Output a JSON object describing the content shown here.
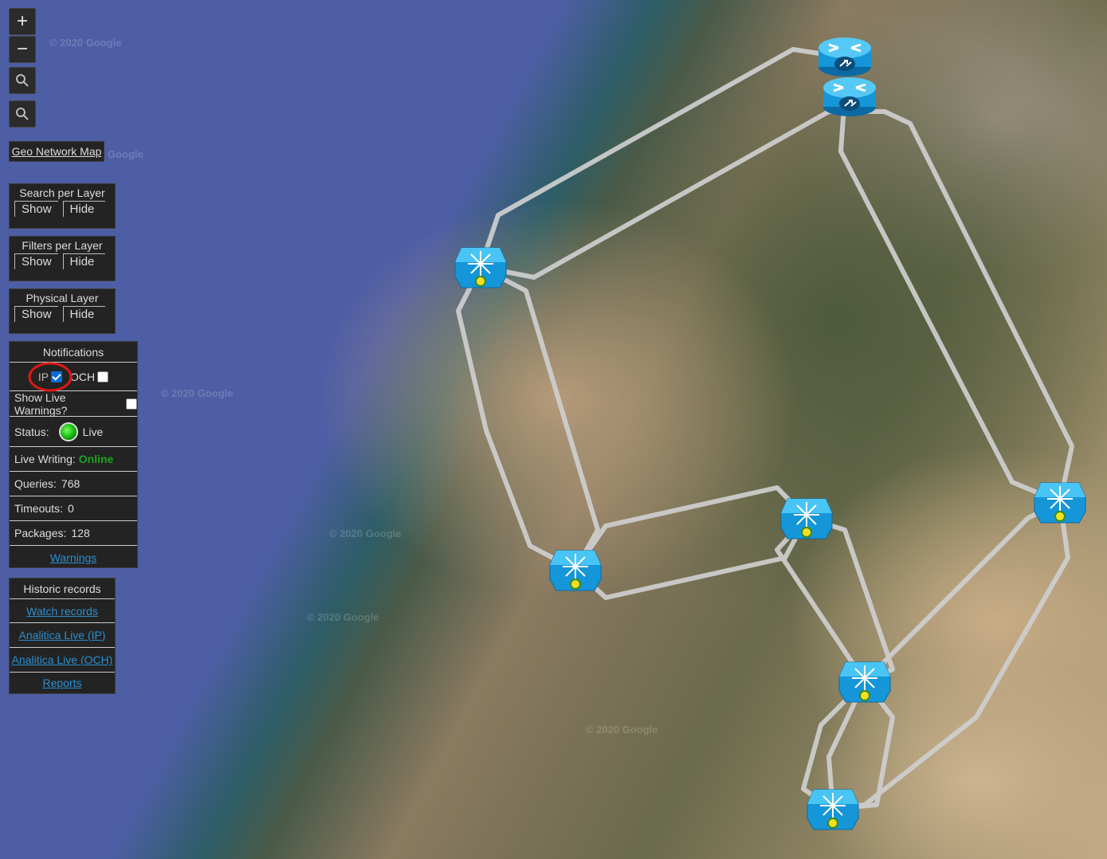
{
  "map": {
    "watermark": "© 2020 Google",
    "watermark_short": "Google",
    "colors": {
      "link": "#cfcfcf",
      "node": "#1fa8e8",
      "node_top": "#5fd0ff"
    }
  },
  "zoom_controls": {
    "zoom_in": "+",
    "zoom_out": "−"
  },
  "geo_map_button": "Geo Network Map",
  "layer_panels": [
    {
      "title": "Search per Layer",
      "show": "Show",
      "hide": "Hide"
    },
    {
      "title": "Filters per Layer",
      "show": "Show",
      "hide": "Hide"
    },
    {
      "title": "Physical Layer",
      "show": "Show",
      "hide": "Hide"
    }
  ],
  "notifications": {
    "title": "Notifications",
    "ip_label": "IP",
    "ip_checked": true,
    "och_label": "OCH",
    "och_checked": false,
    "show_live_warnings": "Show Live Warnings?",
    "status_label": "Status:",
    "status_value": "Live",
    "live_writing_label": "Live Writing:",
    "live_writing_value": "Online",
    "queries_label": "Queries:",
    "queries_value": "768",
    "timeouts_label": "Timeouts:",
    "timeouts_value": "0",
    "packages_label": "Packages:",
    "packages_value": "128",
    "warnings_link": "Warnings"
  },
  "historic": {
    "title": "Historic records",
    "links": [
      "Watch records",
      "Analitica Live (IP)",
      "Analitica Live (OCH)",
      "Reports"
    ]
  }
}
